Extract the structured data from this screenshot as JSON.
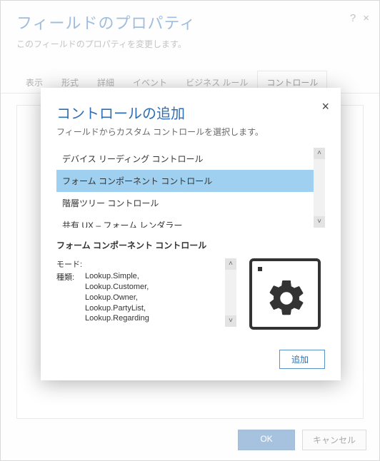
{
  "header": {
    "title": "フィールドのプロパティ",
    "subtitle": "このフィールドのプロパティを変更します。",
    "help_icon": "?",
    "close_icon": "×"
  },
  "tabs": {
    "items": [
      {
        "label": "表示"
      },
      {
        "label": "形式"
      },
      {
        "label": "詳細"
      },
      {
        "label": "イベント"
      },
      {
        "label": "ビジネス ルール"
      },
      {
        "label": "コントロール"
      }
    ],
    "active": 5
  },
  "footer": {
    "ok": "OK",
    "cancel": "キャンセル"
  },
  "modal": {
    "title": "コントロールの追加",
    "subtitle": "フィールドからカスタム コントロールを選択します。",
    "close": "×",
    "list": [
      {
        "label": "デバイス リーディング コントロール",
        "selected": false
      },
      {
        "label": "フォーム コンポーネント コントロール",
        "selected": true
      },
      {
        "label": "階層ツリー コントロール",
        "selected": false
      },
      {
        "label": "共有 UX – フォーム レンダラー",
        "selected": false
      }
    ],
    "scroll_up": "˄",
    "scroll_down": "˅",
    "detail": {
      "title": "フォーム コンポーネント コントロール",
      "mode_label": "モード:",
      "kind_label": "種類:",
      "kinds": [
        "Lookup.Simple,",
        "Lookup.Customer,",
        "Lookup.Owner,",
        "Lookup.PartyList,",
        "Lookup.Regarding"
      ]
    },
    "add_label": "追加"
  }
}
